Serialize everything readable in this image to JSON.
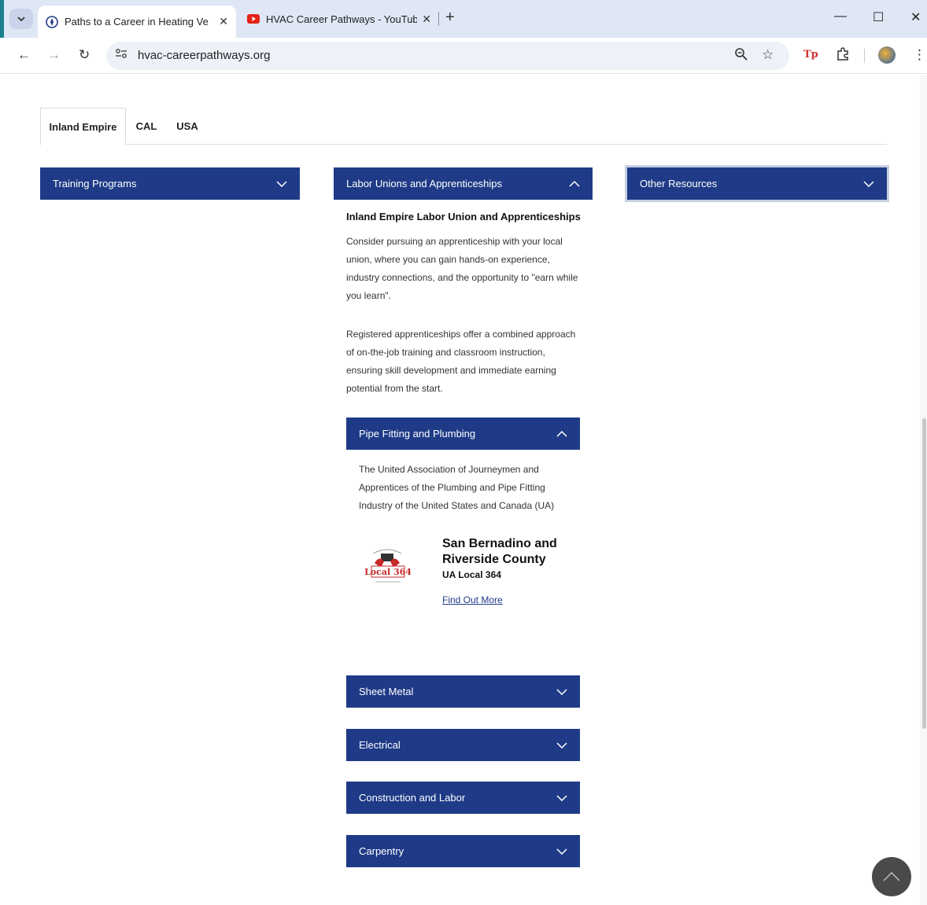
{
  "browser": {
    "tabs": [
      {
        "title": "Paths to a Career in Heating Ve",
        "active": true
      },
      {
        "title": "HVAC Career Pathways - YouTub",
        "active": false
      }
    ],
    "url": "hvac-careerpathways.org",
    "extension_badge": "Tp"
  },
  "page": {
    "region_tabs": [
      "Inland Empire",
      "CAL",
      "USA"
    ],
    "active_region": "Inland Empire",
    "accordions": {
      "training": "Training Programs",
      "unions": "Labor Unions and Apprenticeships",
      "other": "Other Resources"
    },
    "unions_section": {
      "title": "Inland Empire Labor Union and Apprenticeships",
      "para1": "Consider pursuing an apprenticeship with your local union, where you can gain hands-on experience, industry connections, and the opportunity to \"earn while you learn\".",
      "para2": "Registered apprenticeships offer a combined approach of on-the-job training and classroom instruction, ensuring skill development and immediate earning potential from the start."
    },
    "trades": {
      "pipe": {
        "label": "Pipe Fitting and Plumbing",
        "description": "The United Association of Journeymen and Apprentices of the Plumbing and Pipe Fitting Industry of the United States and Canada (UA)",
        "card": {
          "title": "San Bernadino and Riverside County",
          "subtitle": "UA Local 364",
          "link": "Find Out More",
          "logo_text": "Local 364"
        }
      },
      "sheet_metal": "Sheet Metal",
      "electrical": "Electrical",
      "construction": "Construction and Labor",
      "carpentry": "Carpentry"
    }
  },
  "colors": {
    "accent": "#1f3b87",
    "tabbar": "#dfe6f4"
  }
}
